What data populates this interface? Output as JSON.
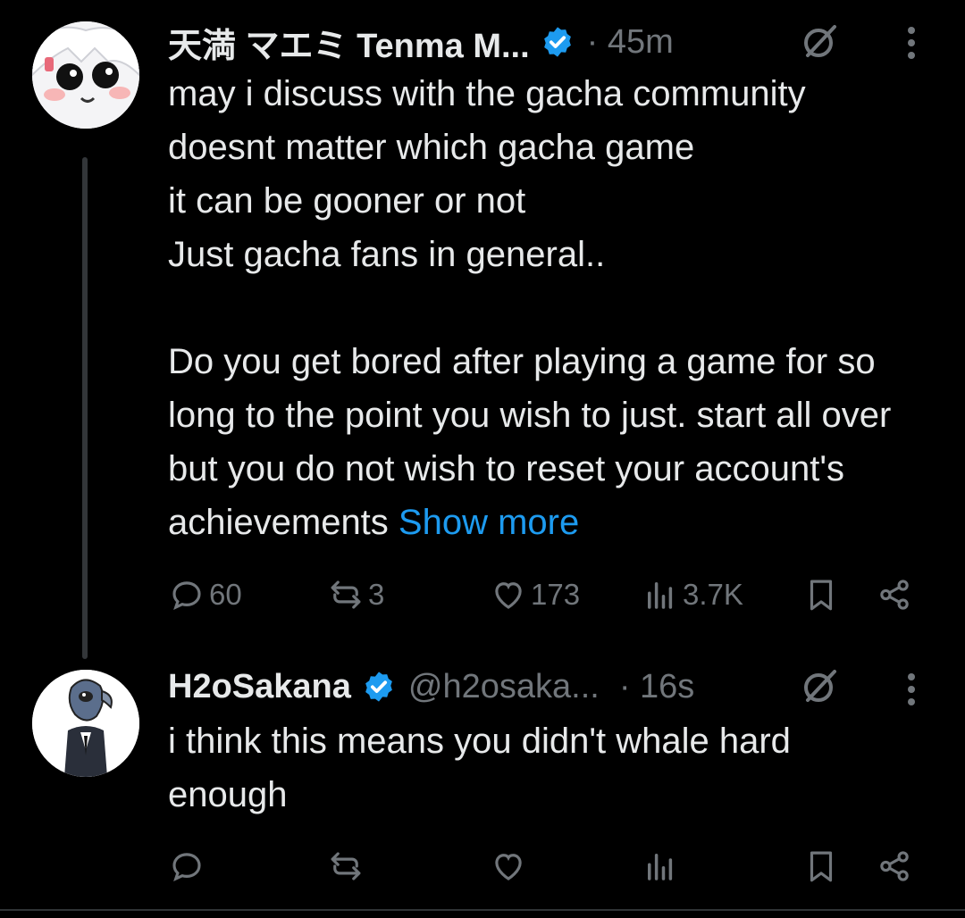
{
  "tweets": [
    {
      "display_name": "天満 マエミ Tenma M...",
      "handle": "",
      "time": "· 45m",
      "text": "may i discuss with the gacha community\ndoesnt matter which gacha game\nit can be gooner or not\nJust gacha fans in general..\n\nDo you get bored after playing a game for so long to the point you wish to just. start all over but you do not wish to reset your account's achievements ",
      "show_more": "Show more",
      "stats": {
        "replies": "60",
        "reposts": "3",
        "likes": "173",
        "views": "3.7K"
      }
    },
    {
      "display_name": "H2oSakana",
      "handle": "@h2osaka...",
      "time": "· 16s",
      "text": "i think this means you didn't whale hard enough",
      "show_more": "",
      "stats": {
        "replies": "",
        "reposts": "",
        "likes": "",
        "views": ""
      }
    }
  ],
  "colors": {
    "accent": "#1d9bf0",
    "muted": "#71767b",
    "text": "#e7e9ea",
    "background": "#000000"
  },
  "icons": [
    "verified-badge-icon",
    "grok-slash-icon",
    "more-vertical-icon",
    "reply-icon",
    "repost-icon",
    "like-icon",
    "views-icon",
    "bookmark-icon",
    "share-icon"
  ]
}
